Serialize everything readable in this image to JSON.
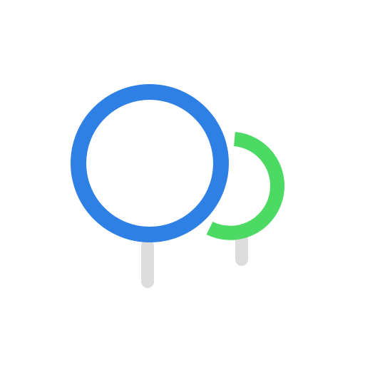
{
  "logo": {
    "icon": "trees-icon",
    "colors": {
      "large_tree": "#2F80E4",
      "small_tree": "#4CD964",
      "trunk": "#DDDDDD",
      "background": "#FFFFFF"
    }
  }
}
